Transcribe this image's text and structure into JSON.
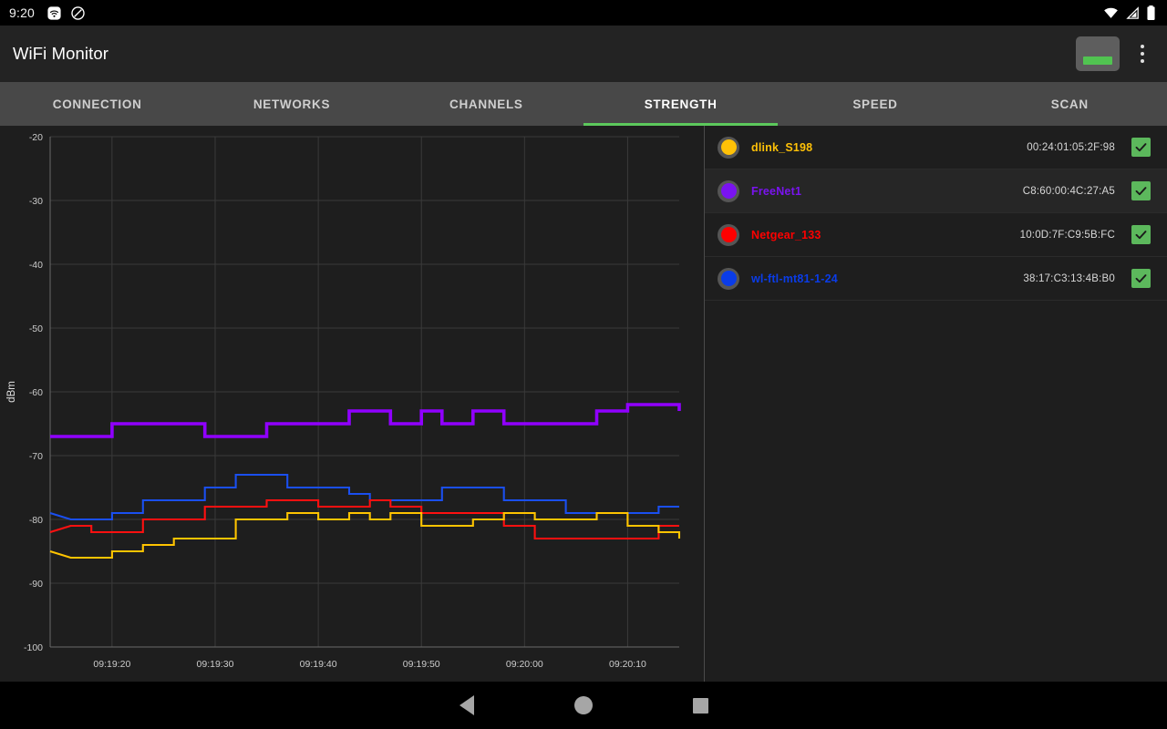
{
  "statusbar": {
    "time": "9:20",
    "left_icons": [
      "wifi-notification-icon",
      "no-disturb-icon"
    ],
    "right_icons": [
      "wifi-signal-icon",
      "cell-signal-icon",
      "battery-icon"
    ]
  },
  "appbar": {
    "title": "WiFi Monitor",
    "toggle_label": "",
    "toggle_icon": "toggle-button",
    "overflow_icon": "overflow-menu-icon",
    "accent_green": "#51c451"
  },
  "tabs": [
    {
      "label": "CONNECTION",
      "active": false
    },
    {
      "label": "NETWORKS",
      "active": false
    },
    {
      "label": "CHANNELS",
      "active": false
    },
    {
      "label": "STRENGTH",
      "active": true
    },
    {
      "label": "SPEED",
      "active": false
    },
    {
      "label": "SCAN",
      "active": false
    }
  ],
  "legend": {
    "rows": [
      {
        "name": "dlink_S198",
        "mac": "00:24:01:05:2F:98",
        "color": "#ffc107",
        "checked": true
      },
      {
        "name": "FreeNet1",
        "mac": "C8:60:00:4C:27:A5",
        "color": "#7a13f0",
        "checked": true
      },
      {
        "name": "Netgear_133",
        "mac": "10:0D:7F:C9:5B:FC",
        "color": "#ff0000",
        "checked": true
      },
      {
        "name": "wl-ftl-mt81-1-24",
        "mac": "38:17:C3:13:4B:B0",
        "color": "#0a3ce8",
        "checked": true
      }
    ],
    "check_color": "#5cb85c"
  },
  "navbar": {
    "back_label": "back-button",
    "home_label": "home-button",
    "recents_label": "recents-button"
  },
  "chart_data": {
    "type": "line",
    "title": "",
    "xlabel": "",
    "ylabel": "dBm",
    "ylim": [
      -100,
      -20
    ],
    "yticks": [
      -20,
      -30,
      -40,
      -50,
      -60,
      -70,
      -80,
      -90,
      -100
    ],
    "ytick_labels": [
      "-20",
      "-30",
      "-40",
      "-50",
      "-60",
      "-70",
      "-80",
      "-90",
      "-100"
    ],
    "xticks": [
      20,
      30,
      40,
      50,
      60,
      70
    ],
    "xtick_labels": [
      "09:19:20",
      "09:19:30",
      "09:19:40",
      "09:19:50",
      "09:20:00",
      "09:20:10"
    ],
    "xlim": [
      14,
      75
    ],
    "grid": true,
    "step": "post",
    "legend_position": "right-panel",
    "series": [
      {
        "name": "FreeNet1",
        "color": "#9000ff",
        "x": [
          14,
          16,
          18,
          20,
          23,
          26,
          29,
          32,
          35,
          37,
          40,
          43,
          45,
          47,
          50,
          52,
          55,
          58,
          61,
          64,
          67,
          70,
          73,
          75
        ],
        "values": [
          -67,
          -67,
          -67,
          -65,
          -65,
          -65,
          -67,
          -67,
          -65,
          -65,
          -65,
          -63,
          -63,
          -65,
          -63,
          -65,
          -63,
          -65,
          -65,
          -65,
          -63,
          -62,
          -62,
          -63
        ]
      },
      {
        "name": "wl-ftl-mt81-1-24",
        "color": "#1a4ff0",
        "x": [
          14,
          16,
          18,
          20,
          23,
          26,
          29,
          32,
          35,
          37,
          40,
          43,
          45,
          47,
          50,
          52,
          55,
          58,
          61,
          64,
          67,
          70,
          73,
          75
        ],
        "values": [
          -79,
          -80,
          -80,
          -79,
          -77,
          -77,
          -75,
          -73,
          -73,
          -75,
          -75,
          -76,
          -77,
          -77,
          -77,
          -75,
          -75,
          -77,
          -77,
          -79,
          -79,
          -79,
          -78,
          -78
        ]
      },
      {
        "name": "Netgear_133",
        "color": "#ff1010",
        "x": [
          14,
          16,
          18,
          20,
          23,
          26,
          29,
          32,
          35,
          37,
          40,
          43,
          45,
          47,
          50,
          52,
          55,
          58,
          61,
          64,
          67,
          70,
          73,
          75
        ],
        "values": [
          -82,
          -81,
          -82,
          -82,
          -80,
          -80,
          -78,
          -78,
          -77,
          -77,
          -78,
          -78,
          -77,
          -78,
          -79,
          -79,
          -79,
          -81,
          -83,
          -83,
          -83,
          -83,
          -81,
          -81
        ]
      },
      {
        "name": "dlink_S198",
        "color": "#ffc400",
        "x": [
          14,
          16,
          18,
          20,
          23,
          26,
          29,
          32,
          35,
          37,
          40,
          43,
          45,
          47,
          50,
          52,
          55,
          58,
          61,
          64,
          67,
          70,
          73,
          75
        ],
        "values": [
          -85,
          -86,
          -86,
          -85,
          -84,
          -83,
          -83,
          -80,
          -80,
          -79,
          -80,
          -79,
          -80,
          -79,
          -81,
          -81,
          -80,
          -79,
          -80,
          -80,
          -79,
          -81,
          -82,
          -83
        ]
      }
    ]
  }
}
